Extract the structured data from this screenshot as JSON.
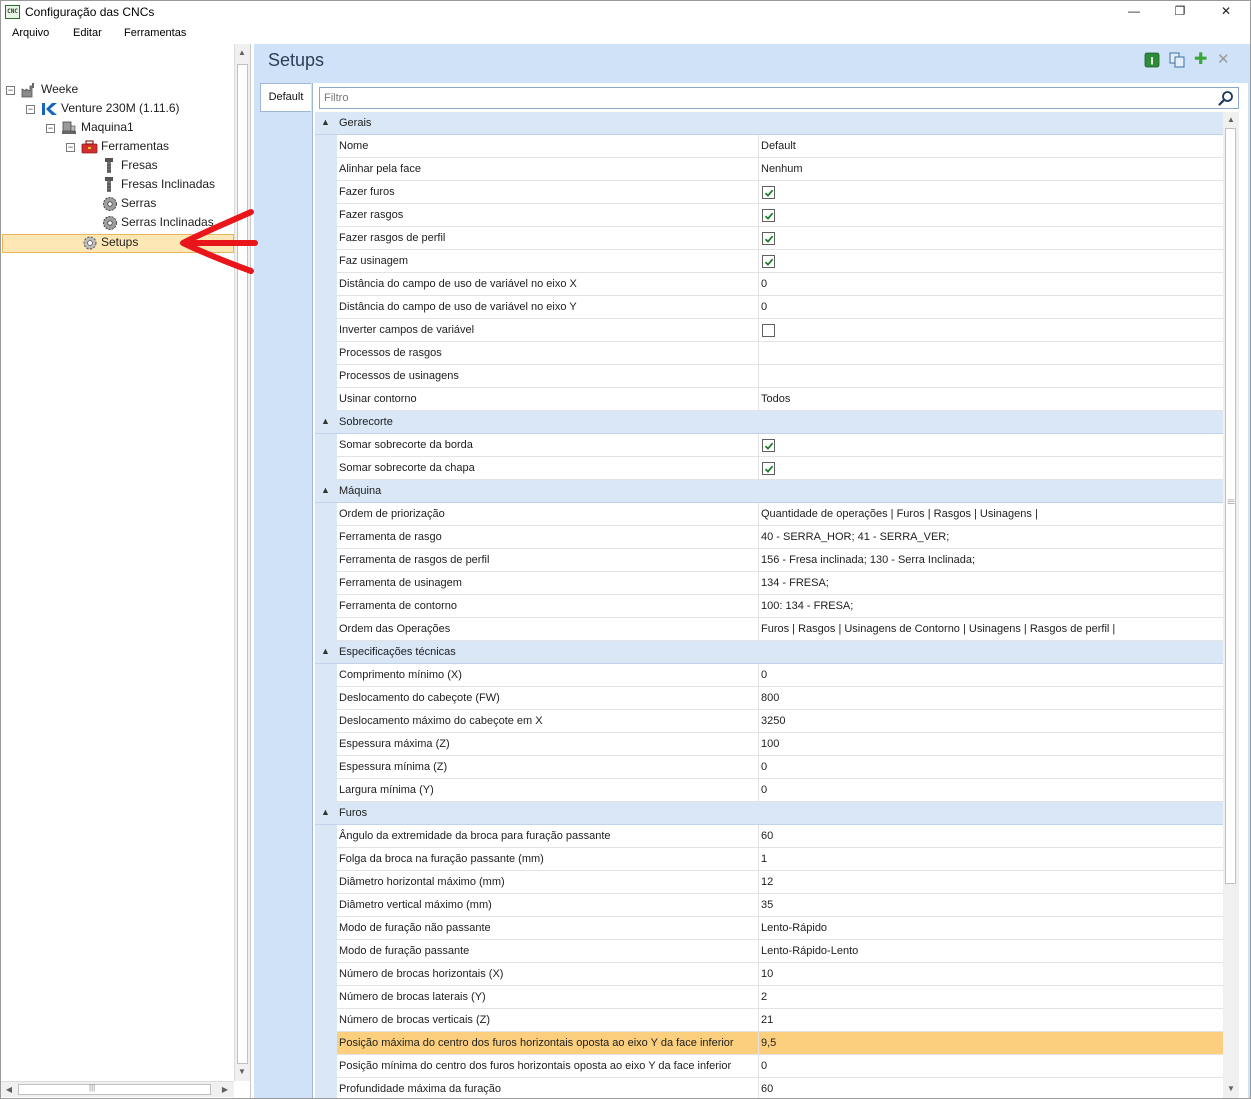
{
  "window": {
    "title": "Configuração das CNCs",
    "app_icon_text": "CNC",
    "min_glyph": "—",
    "max_glyph": "❐",
    "close_glyph": "✕"
  },
  "menu": [
    "Arquivo",
    "Editar",
    "Ferramentas"
  ],
  "tree": {
    "nodes": [
      {
        "label": "Weeke",
        "icon": "factory-icon"
      },
      {
        "label": "Venture 230M (1.11.6)",
        "icon": "machine-brand-icon"
      },
      {
        "label": "Maquina1",
        "icon": "machine-icon"
      },
      {
        "label": "Ferramentas",
        "icon": "toolbox-icon"
      },
      {
        "label": "Fresas",
        "icon": "mill-bit-icon"
      },
      {
        "label": "Fresas Inclinadas",
        "icon": "mill-bit-icon"
      },
      {
        "label": "Serras",
        "icon": "saw-blade-icon"
      },
      {
        "label": "Serras Inclinadas",
        "icon": "saw-blade-icon"
      },
      {
        "label": "Setups",
        "icon": "gear-icon",
        "selected": true
      }
    ],
    "toggle_glyph": "−"
  },
  "panel": {
    "title": "Setups",
    "tab": "Default",
    "filter_placeholder": "Filtro",
    "toolbar_icons": [
      "info-icon",
      "copy-icon",
      "add-icon",
      "delete-icon"
    ],
    "add_glyph": "✚",
    "delete_glyph": "✕",
    "info_glyph": "I"
  },
  "grid": {
    "collapse_glyph": "▲",
    "rows": [
      {
        "type": "category",
        "label": "Gerais"
      },
      {
        "type": "prop",
        "name": "Nome",
        "value": "Default"
      },
      {
        "type": "prop",
        "name": "Alinhar pela face",
        "value": "Nenhum"
      },
      {
        "type": "check",
        "name": "Fazer furos",
        "checked": true
      },
      {
        "type": "check",
        "name": "Fazer rasgos",
        "checked": true
      },
      {
        "type": "check",
        "name": "Fazer rasgos de perfil",
        "checked": true
      },
      {
        "type": "check",
        "name": "Faz usinagem",
        "checked": true
      },
      {
        "type": "prop",
        "name": "Distância do campo de uso de variável no eixo X",
        "value": "0"
      },
      {
        "type": "prop",
        "name": "Distância do campo de uso de variável no eixo Y",
        "value": "0"
      },
      {
        "type": "check",
        "name": "Inverter campos de variável",
        "checked": false
      },
      {
        "type": "prop",
        "name": "Processos de rasgos",
        "value": ""
      },
      {
        "type": "prop",
        "name": "Processos de usinagens",
        "value": ""
      },
      {
        "type": "prop",
        "name": "Usinar contorno",
        "value": "Todos"
      },
      {
        "type": "category",
        "label": "Sobrecorte"
      },
      {
        "type": "check",
        "name": "Somar sobrecorte da borda",
        "checked": true
      },
      {
        "type": "check",
        "name": "Somar sobrecorte da chapa",
        "checked": true
      },
      {
        "type": "category",
        "label": "Máquina"
      },
      {
        "type": "prop",
        "name": "Ordem de priorização",
        "value": "Quantidade de operações | Furos | Rasgos | Usinagens |"
      },
      {
        "type": "prop",
        "name": "Ferramenta de rasgo",
        "value": "40 - SERRA_HOR; 41 - SERRA_VER;"
      },
      {
        "type": "prop",
        "name": "Ferramenta de rasgos de perfil",
        "value": "156 - Fresa inclinada; 130 - Serra Inclinada;"
      },
      {
        "type": "prop",
        "name": "Ferramenta de usinagem",
        "value": "134 - FRESA;"
      },
      {
        "type": "prop",
        "name": "Ferramenta de contorno",
        "value": "100: 134 - FRESA;"
      },
      {
        "type": "prop",
        "name": "Ordem das Operações",
        "value": "Furos | Rasgos | Usinagens de Contorno | Usinagens | Rasgos de perfil |"
      },
      {
        "type": "category",
        "label": "Especificações técnicas"
      },
      {
        "type": "prop",
        "name": "Comprimento mínimo (X)",
        "value": "0"
      },
      {
        "type": "prop",
        "name": "Deslocamento do cabeçote (FW)",
        "value": "800"
      },
      {
        "type": "prop",
        "name": "Deslocamento máximo do cabeçote em X",
        "value": "3250"
      },
      {
        "type": "prop",
        "name": "Espessura máxima (Z)",
        "value": "100"
      },
      {
        "type": "prop",
        "name": "Espessura mínima (Z)",
        "value": "0"
      },
      {
        "type": "prop",
        "name": "Largura mínima (Y)",
        "value": "0"
      },
      {
        "type": "category",
        "label": "Furos"
      },
      {
        "type": "prop",
        "name": "Ângulo da extremidade da broca para furação passante",
        "value": "60"
      },
      {
        "type": "prop",
        "name": "Folga da broca na furação passante (mm)",
        "value": "1"
      },
      {
        "type": "prop",
        "name": "Diâmetro horizontal máximo (mm)",
        "value": "12"
      },
      {
        "type": "prop",
        "name": "Diâmetro vertical máximo (mm)",
        "value": "35"
      },
      {
        "type": "prop",
        "name": "Modo de furação não passante",
        "value": "Lento-Rápido"
      },
      {
        "type": "prop",
        "name": "Modo de furação passante",
        "value": "Lento-Rápido-Lento"
      },
      {
        "type": "prop",
        "name": "Número de brocas horizontais (X)",
        "value": "10"
      },
      {
        "type": "prop",
        "name": "Número de brocas laterais (Y)",
        "value": "2"
      },
      {
        "type": "prop",
        "name": "Número de brocas verticais (Z)",
        "value": "21"
      },
      {
        "type": "prop",
        "name": "Posição máxima do centro dos furos horizontais oposta ao eixo Y da face inferior",
        "value": "9,5",
        "highlighted": true
      },
      {
        "type": "prop",
        "name": "Posição mínima do centro dos furos horizontais oposta ao eixo Y da face inferior",
        "value": "0"
      },
      {
        "type": "prop",
        "name": "Profundidade máxima da furação",
        "value": "60"
      }
    ]
  },
  "scroll": {
    "up": "▲",
    "down": "▼",
    "left": "◀",
    "right": "▶",
    "grip": "|||"
  },
  "colors": {
    "accent_panel": "#cfe2f7",
    "category_bg": "#d9e7f7",
    "selection": "#fbcf7d",
    "annotation_arrow": "#e8161b"
  }
}
